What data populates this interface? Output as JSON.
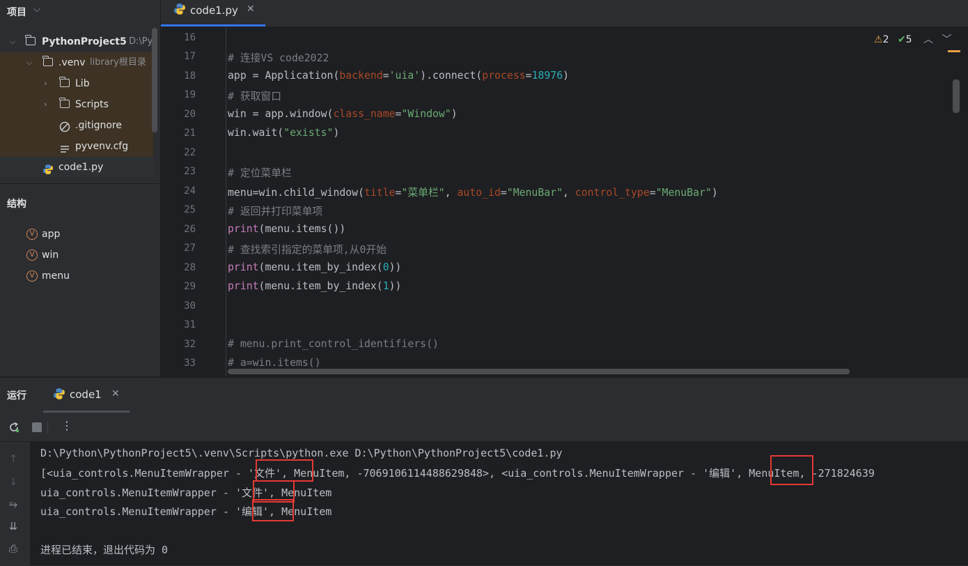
{
  "project_panel": {
    "title": "项目",
    "tree": [
      {
        "label": "PythonProject5",
        "extra": "D:\\Pyt"
      },
      {
        "label": ".venv",
        "extra": "library根目录"
      },
      {
        "label": "Lib"
      },
      {
        "label": "Scripts"
      },
      {
        "label": ".gitignore"
      },
      {
        "label": "pyvenv.cfg"
      },
      {
        "label": "code1.py"
      }
    ]
  },
  "structure_panel": {
    "title": "结构",
    "items": [
      {
        "badge": "V",
        "label": "app"
      },
      {
        "badge": "V",
        "label": "win"
      },
      {
        "badge": "V",
        "label": "menu"
      }
    ]
  },
  "editor": {
    "tab_label": "code1.py",
    "warnings": "2",
    "checks": "5",
    "line_numbers": [
      "16",
      "17",
      "18",
      "19",
      "20",
      "21",
      "22",
      "23",
      "24",
      "25",
      "26",
      "27",
      "28",
      "29",
      "30",
      "31",
      "32",
      "33"
    ],
    "lines": {
      "l17": "# 连接VS code2022",
      "l18": {
        "a": "app = Application(",
        "b": "backend",
        "c": "=",
        "d": "'uia'",
        "e": ").connect(",
        "f": "process",
        "g": "=",
        "h": "18976",
        "i": ")"
      },
      "l19": "# 获取窗口",
      "l20": {
        "a": "win = app.window(",
        "b": "class_name",
        "c": "=",
        "d": "\"Window\"",
        "e": ")"
      },
      "l21": {
        "a": "win.wait(",
        "b": "\"exists\"",
        "c": ")"
      },
      "l23": "# 定位菜单栏",
      "l24": {
        "a": "menu=win.child_window(",
        "b": "title",
        "c": "=",
        "d": "\"菜单栏\"",
        "e": ", ",
        "f": "auto_id",
        "g": "=",
        "h": "\"MenuBar\"",
        "i": ", ",
        "j": "control_type",
        "k": "=",
        "l": "\"MenuBar\"",
        "m": ")"
      },
      "l25": "# 返回并打印菜单项",
      "l26": {
        "a": "print",
        "b": "(menu.items())"
      },
      "l27": "# 查找索引指定的菜单项,从0开始",
      "l28": {
        "a": "print",
        "b": "(menu.item_by_index(",
        "c": "0",
        "d": "))"
      },
      "l29": {
        "a": "print",
        "b": "(menu.item_by_index(",
        "c": "1",
        "d": "))"
      },
      "l32": "# menu.print_control_identifiers()",
      "l33": "# a=win.items()"
    }
  },
  "run_panel": {
    "title": "运行",
    "tab_label": "code1",
    "console_lines": [
      "D:\\Python\\PythonProject5\\.venv\\Scripts\\python.exe D:\\Python\\PythonProject5\\code1.py",
      "[<uia_controls.MenuItemWrapper - '文件', MenuItem, -7069106114488629848>, <uia_controls.MenuItemWrapper - '编辑', MenuItem, -271824639",
      "uia_controls.MenuItemWrapper - '文件', MenuItem",
      "uia_controls.MenuItemWrapper - '编辑', MenuItem",
      "",
      "进程已结束，退出代码为 0"
    ]
  },
  "colors": {
    "accent": "#3574f0",
    "highlight_box": "#e53935",
    "comment": "#7a7e85",
    "string": "#6aab73",
    "number": "#2aacb8",
    "param": "#aa4926",
    "builtin": "#c77dba"
  }
}
